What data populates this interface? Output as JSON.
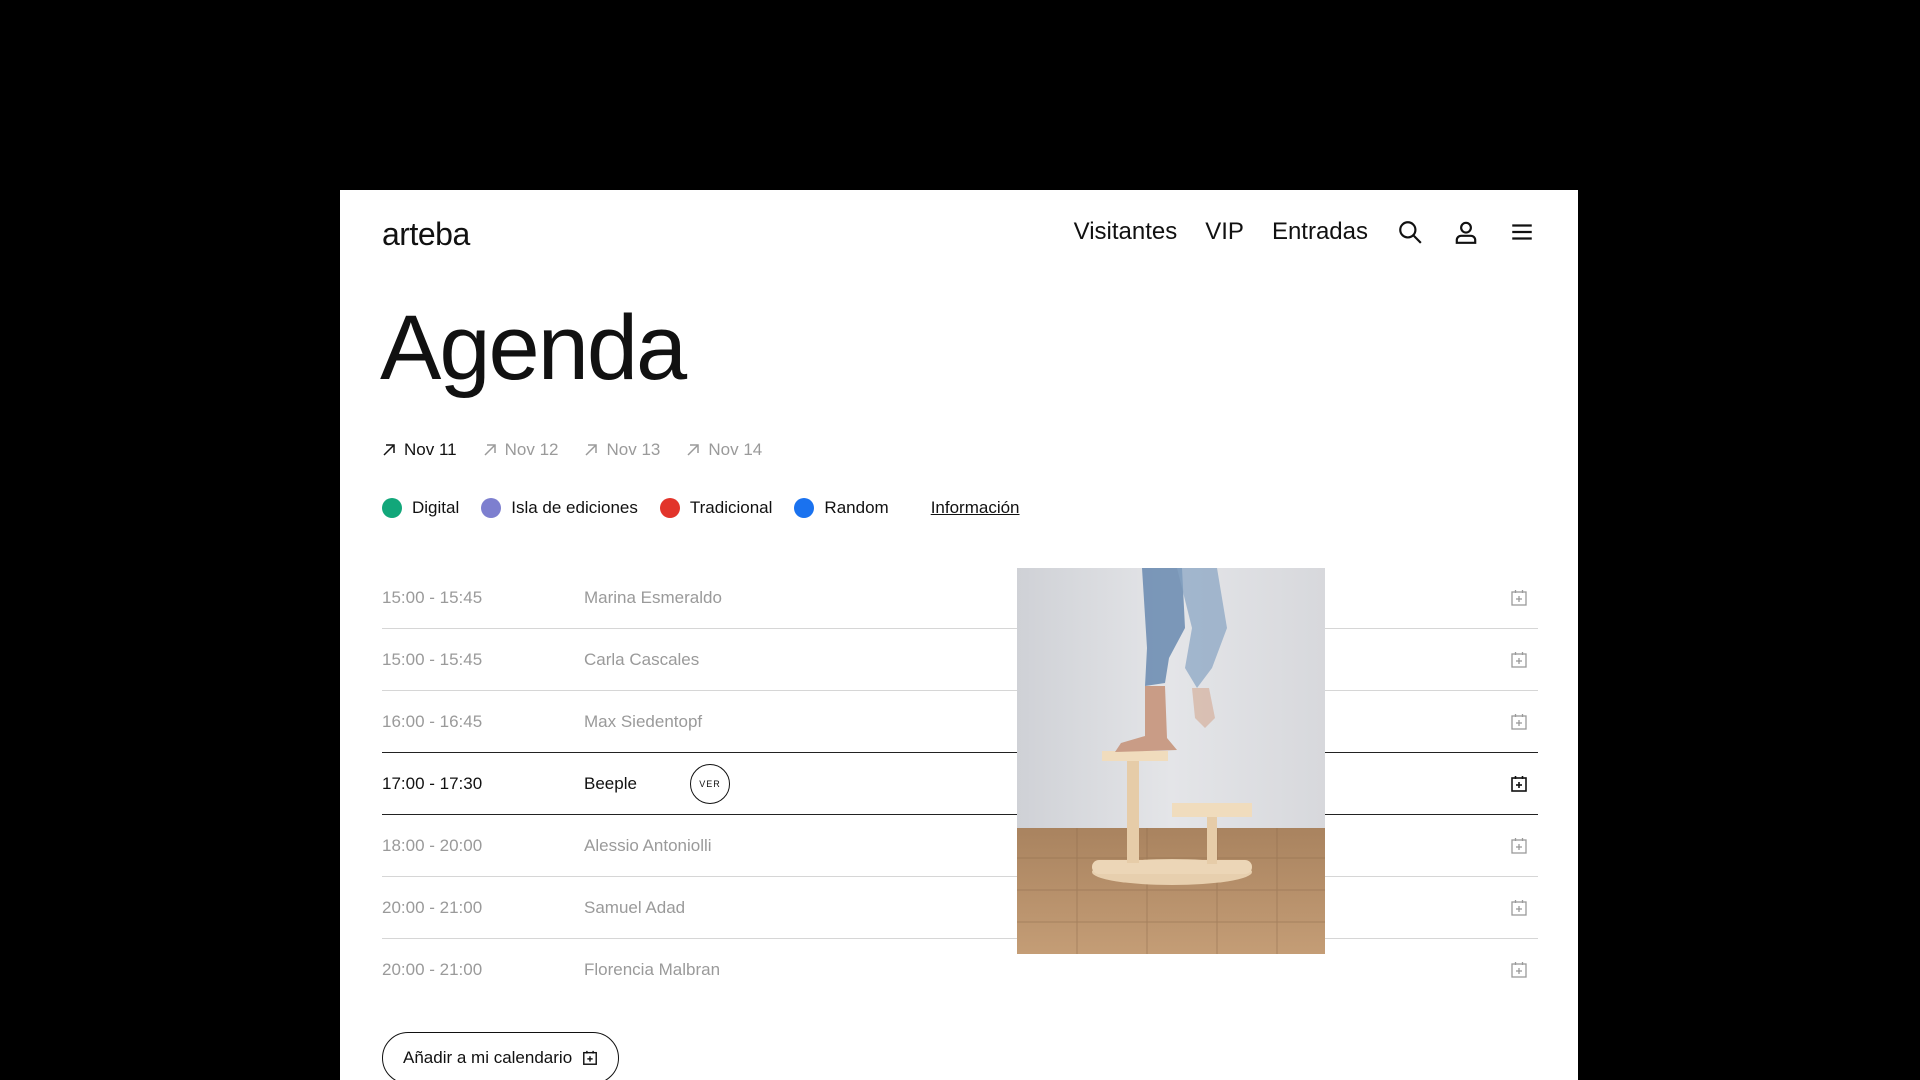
{
  "header": {
    "logo": "arteba",
    "nav": [
      "Visitantes",
      "VIP",
      "Entradas"
    ]
  },
  "icons": {
    "search": "search-icon",
    "user": "user-icon",
    "menu": "menu-icon",
    "arrow": "arrow-up-right-icon",
    "calendar": "calendar-add-icon"
  },
  "page_title": "Agenda",
  "days": [
    {
      "label": "Nov 11",
      "active": true
    },
    {
      "label": "Nov 12",
      "active": false
    },
    {
      "label": "Nov 13",
      "active": false
    },
    {
      "label": "Nov 14",
      "active": false
    }
  ],
  "legend": [
    {
      "label": "Digital",
      "color": "#12a77a"
    },
    {
      "label": "Isla de ediciones",
      "color": "#7d7fcf"
    },
    {
      "label": "Tradicional",
      "color": "#e2342b"
    },
    {
      "label": "Random",
      "color": "#1a72ef"
    }
  ],
  "info_link": "Información",
  "schedule": [
    {
      "time": "15:00 - 15:45",
      "name": "Marina Esmeraldo"
    },
    {
      "time": "15:00 - 15:45",
      "name": "Carla Cascales"
    },
    {
      "time": "16:00 - 16:45",
      "name": "Max Siedentopf"
    },
    {
      "time": "17:00 - 17:30",
      "name": "Beeple",
      "active": true,
      "ver": "VER"
    },
    {
      "time": "18:00 - 20:00",
      "name": "Alessio Antoniolli"
    },
    {
      "time": "20:00 - 21:00",
      "name": "Samuel Adad"
    },
    {
      "time": "20:00 - 21:00",
      "name": "Florencia Malbran"
    }
  ],
  "cta": "Añadir a mi calendario",
  "colors": {
    "background": "#000000",
    "panel": "#ffffff",
    "muted_text": "#9a9a9a"
  }
}
